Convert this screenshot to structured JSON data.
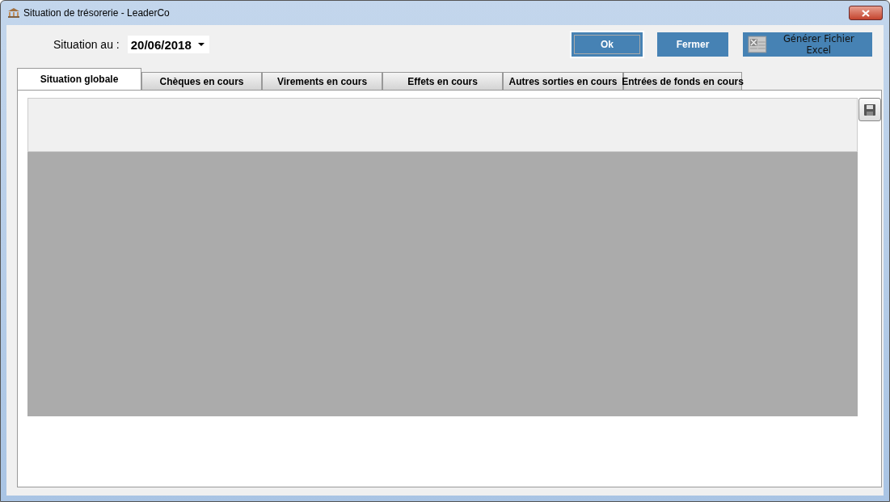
{
  "window": {
    "title": "Situation de trésorerie - LeaderCo"
  },
  "date_field": {
    "label": "Situation au :",
    "value": "20/06/2018"
  },
  "buttons": [
    {
      "label": "Ok",
      "kind": "plain",
      "focused": true
    },
    {
      "label": "Fermer",
      "kind": "plain",
      "focused": false
    },
    {
      "label": "Générer Fichier Excel",
      "kind": "excel",
      "focused": false
    }
  ],
  "tabs": [
    {
      "label": "Situation globale",
      "selected": true
    },
    {
      "label": "Chèques en cours",
      "selected": false
    },
    {
      "label": "Virements en cours",
      "selected": false
    },
    {
      "label": "Effets en cours",
      "selected": false
    },
    {
      "label": "Autres sorties en cours",
      "selected": false
    },
    {
      "label": "Entrées de fonds en cours",
      "selected": false
    }
  ]
}
